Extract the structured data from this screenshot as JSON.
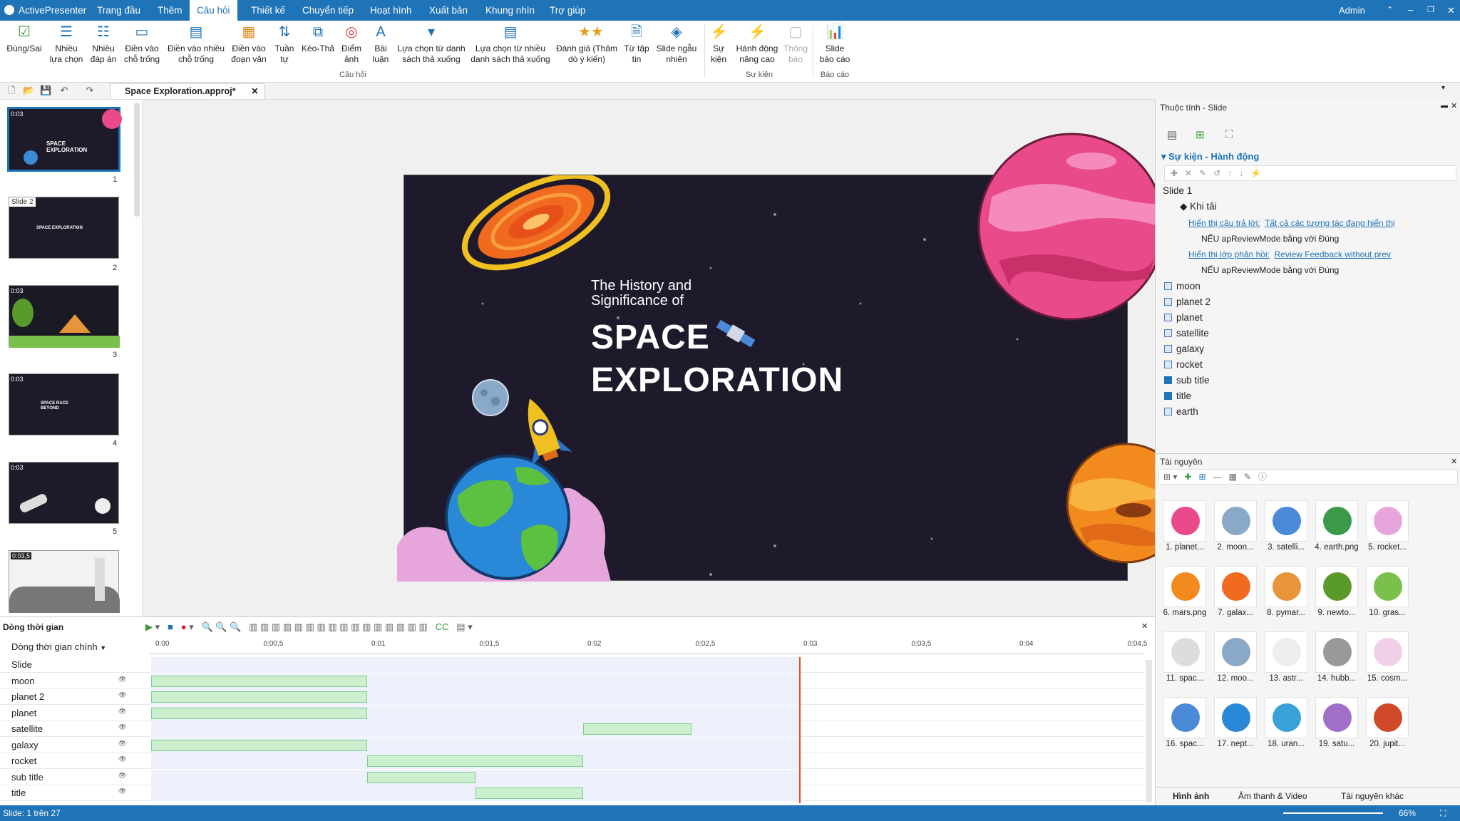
{
  "app": {
    "name": "ActivePresenter",
    "user": "Admin"
  },
  "menu": [
    "Trang đầu",
    "Thêm",
    "Câu hỏi",
    "Thiết kế",
    "Chuyển tiếp",
    "Hoạt hình",
    "Xuất bản",
    "Khung nhìn",
    "Trợ giúp"
  ],
  "ribbon": {
    "buttons": [
      "Đúng/Sai",
      "Nhiều\nlựa chọn",
      "Nhiều\nđáp án",
      "Điền vào\nchỗ trống",
      "Điền vào nhiều\nchỗ trống",
      "Điền vào\nđoạn văn",
      "Tuần\ntự",
      "Kéo-Thả",
      "Điểm\nảnh",
      "Bài\nluận",
      "Lựa chọn từ danh\nsách thả xuống",
      "Lựa chọn từ nhiều\ndanh sách thả xuống",
      "Đánh giá (Thăm\ndò ý kiến)",
      "Từ tập\ntin",
      "Slide ngẫu\nnhiên",
      "Sự\nkiện",
      "Hành động\nnâng cao",
      "Thông\nbáo",
      "Slide\nbáo cáo"
    ],
    "groups": [
      "Câu hỏi",
      "Sự kiện",
      "Báo cáo"
    ]
  },
  "document": {
    "tab": "Space Exploration.approj*"
  },
  "thumbnails": [
    {
      "num": "1",
      "time": "0:03",
      "label": ""
    },
    {
      "num": "2",
      "time": "",
      "label": "Slide 2"
    },
    {
      "num": "3",
      "time": "0:03",
      "label": ""
    },
    {
      "num": "4",
      "time": "0:03",
      "label": ""
    },
    {
      "num": "5",
      "time": "0:03",
      "label": ""
    },
    {
      "num": "",
      "time": "0:03,5",
      "label": ""
    }
  ],
  "slide": {
    "subtitle_line1": "The History and",
    "subtitle_line2": "Significance of",
    "title_line1": "SPACE",
    "title_line2": "EXPLORATION"
  },
  "properties": {
    "title": "Thuộc tính - Slide",
    "section": "Sự kiện - Hành động",
    "slide_name": "Slide 1",
    "event": "Khi tải",
    "action1_a": "Hiển thị câu trả lời:",
    "action1_b": "Tất cả các tương tác đang hiển thị",
    "cond1": "NẾU apReviewMode bằng với Đúng",
    "action2_a": "Hiển thị lớp phản hồi:",
    "action2_b": "Review Feedback without prev",
    "cond2": "NẾU apReviewMode bằng với Đúng",
    "objects": [
      "moon",
      "planet 2",
      "planet",
      "satellite",
      "galaxy",
      "rocket",
      "sub title",
      "title",
      "earth"
    ]
  },
  "resources": {
    "title": "Tài nguyên",
    "items": [
      "1. planet...",
      "2. moon...",
      "3. satelli...",
      "4. earth.png",
      "5. rocket...",
      "6. mars.png",
      "7. galax...",
      "8. pymar...",
      "9. newto...",
      "10. gras...",
      "11. spac...",
      "12. moo...",
      "13. astr...",
      "14. hubb...",
      "15. cosm...",
      "16. spac...",
      "17. nept...",
      "18. uran...",
      "19. satu...",
      "20. jupit..."
    ],
    "tabs": [
      "Hình ảnh",
      "Âm thanh & Video",
      "Tài nguyên khác"
    ]
  },
  "timeline": {
    "title": "Dòng thời gian",
    "main": "Dòng thời gian chính",
    "ticks": [
      "0:00",
      "0:00,5",
      "0:01",
      "0:01,5",
      "0:02",
      "0:02,5",
      "0:03",
      "0:03,5",
      "0:04",
      "0:04,5"
    ],
    "rows": [
      "Slide",
      "moon",
      "planet 2",
      "planet",
      "satellite",
      "galaxy",
      "rocket",
      "sub title",
      "title"
    ]
  },
  "status": {
    "left": "Slide: 1 trên 27",
    "zoom": "66%"
  },
  "colors": {
    "accent": "#1f73b7",
    "slide_bg": "#1e1a2c",
    "bar": "#ccefd0"
  }
}
